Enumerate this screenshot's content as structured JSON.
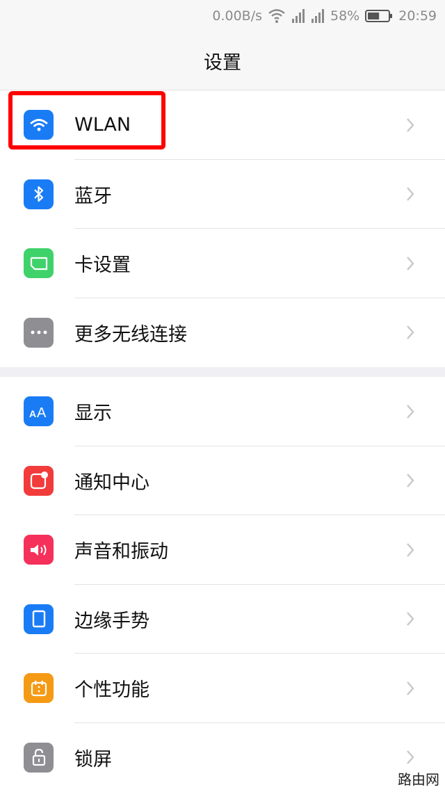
{
  "status_bar": {
    "speed": "0.00B/s",
    "battery_percent": "58%",
    "battery_level": 0.58,
    "time": "20:59"
  },
  "header": {
    "title": "设置"
  },
  "group1": [
    {
      "label": "WLAN",
      "icon": "wifi-icon",
      "color": "#1a7cf5"
    },
    {
      "label": "蓝牙",
      "icon": "bluetooth-icon",
      "color": "#1a7cf5"
    },
    {
      "label": "卡设置",
      "icon": "sim-card-icon",
      "color": "#3fd26a"
    },
    {
      "label": "更多无线连接",
      "icon": "more-dots-icon",
      "color": "#8e8e93"
    }
  ],
  "group2": [
    {
      "label": "显示",
      "icon": "display-aa-icon",
      "color": "#1a7cf5"
    },
    {
      "label": "通知中心",
      "icon": "notification-icon",
      "color": "#f23b3b"
    },
    {
      "label": "声音和振动",
      "icon": "sound-icon",
      "color": "#f5305a"
    },
    {
      "label": "边缘手势",
      "icon": "edge-gesture-icon",
      "color": "#1a7cf5"
    },
    {
      "label": "个性功能",
      "icon": "features-icon",
      "color": "#f59a14"
    },
    {
      "label": "锁屏",
      "icon": "lock-icon",
      "color": "#8e8e93"
    }
  ],
  "watermark": "路由网",
  "colors": {
    "highlight": "#ff0000",
    "chevron": "#c7c7cc"
  }
}
